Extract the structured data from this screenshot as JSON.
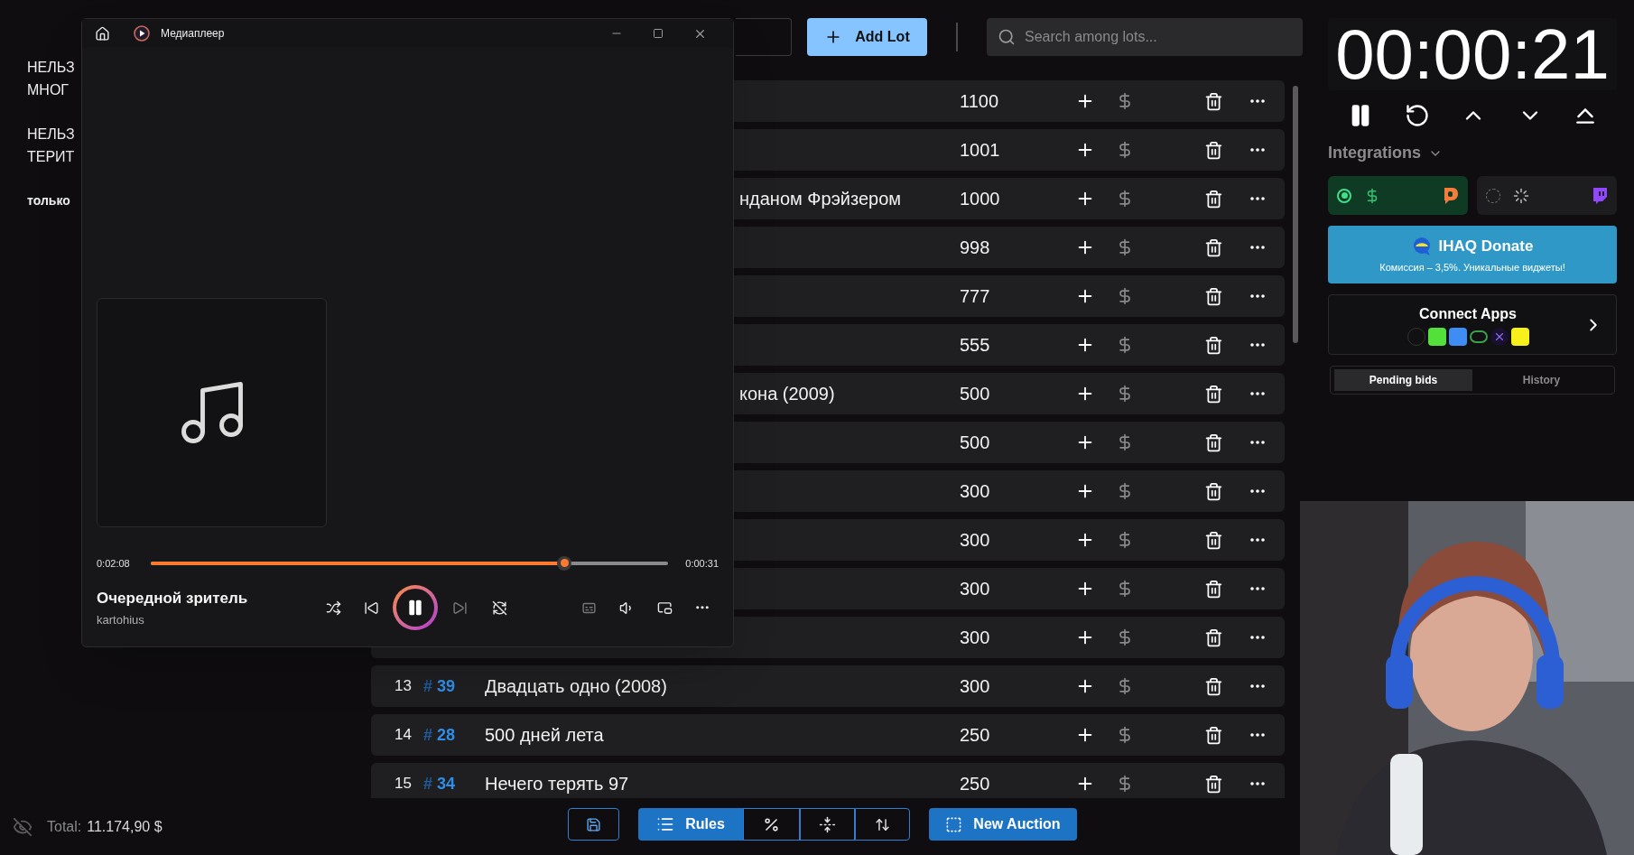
{
  "notes": [
    [
      "НЕЛЬЗ",
      "МНОГ"
    ],
    [
      "НЕЛЬЗ",
      "ТЕРИТ"
    ],
    [
      "только"
    ]
  ],
  "media_player": {
    "title": "Медиаплеер",
    "elapsed": "0:02:08",
    "remaining": "0:00:31",
    "level": 0.8,
    "playing": true,
    "track_title": "Очередной зритель",
    "artist": "kartohius"
  },
  "toolbar": {
    "add_button": "Add Lot",
    "search": {
      "placeholder": "Search among lots..."
    }
  },
  "lots": [
    {
      "kind": "covered",
      "amount": "1100"
    },
    {
      "kind": "covered",
      "amount": "1001"
    },
    {
      "kind": "covered",
      "title": "нданом Фрэйзером",
      "amount": "1000"
    },
    {
      "kind": "covered",
      "amount": "998"
    },
    {
      "kind": "covered",
      "amount": "777"
    },
    {
      "kind": "covered",
      "amount": "555"
    },
    {
      "kind": "covered",
      "title": "кона (2009)",
      "amount": "500"
    },
    {
      "kind": "covered",
      "amount": "500"
    },
    {
      "kind": "covered",
      "amount": "300"
    },
    {
      "kind": "covered",
      "amount": "300"
    },
    {
      "kind": "covered",
      "amount": "300"
    },
    {
      "kind": "covered",
      "amount": "300"
    },
    {
      "kind": "full",
      "number": "13",
      "tag": {
        "mark": "#",
        "id": "39"
      },
      "title": "Двадцать одно (2008)",
      "amount": "300"
    },
    {
      "kind": "full",
      "number": "14",
      "tag": {
        "mark": "#",
        "id": "28"
      },
      "title": "500 дней лета",
      "amount": "250"
    },
    {
      "kind": "full",
      "number": "15",
      "tag": {
        "mark": "#",
        "id": "34"
      },
      "title": "Нечего терять 97",
      "amount": "250"
    }
  ],
  "footer": {
    "total_label": "Total:",
    "total": "11.174,90 $",
    "rules": "Rules",
    "new_auction": "New Auction"
  },
  "timer": "00:00:21",
  "integrations": {
    "label": "Integrations",
    "cards": [
      {
        "kind": "donationalerts",
        "on": true
      },
      {
        "kind": "twitch",
        "on": false
      }
    ]
  },
  "donate_banner": {
    "title": "IHAQ Donate",
    "subtitle": "Комиссия – 3,5%. Уникальные виджеты!"
  },
  "connect_apps": {
    "title": "Connect Apps"
  },
  "tabs": [
    {
      "label": "Pending bids",
      "selected": true
    },
    {
      "label": "History",
      "selected": false
    }
  ]
}
